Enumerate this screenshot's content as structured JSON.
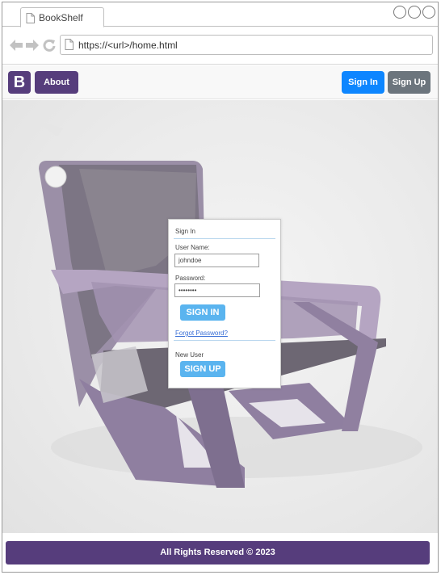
{
  "browser": {
    "tab_title": "BookShelf",
    "url": "https://<url>/home.html",
    "icons": {
      "back": "arrow-left-icon",
      "forward": "arrow-right-icon",
      "reload": "reload-icon",
      "page": "document-icon"
    }
  },
  "navbar": {
    "brand": "B",
    "about": "About",
    "sign_in": "Sign In",
    "sign_up": "Sign Up"
  },
  "login": {
    "header": "Sign In",
    "username_label": "User Name:",
    "username_value": "johndoe",
    "password_label": "Password:",
    "password_value": "••••••••",
    "sign_in_button": "SIGN IN",
    "forgot_link": "Forgot Password?",
    "new_user_label": "New User",
    "sign_up_button": "SIGN UP"
  },
  "footer": {
    "text": "All Rights Reserved © 2023"
  },
  "colors": {
    "brand_purple": "#563d7c",
    "primary_blue": "#0d86ff",
    "secondary_gray": "#6c757d",
    "login_button": "#5ab4ef",
    "hero_image": "chair-photo"
  }
}
